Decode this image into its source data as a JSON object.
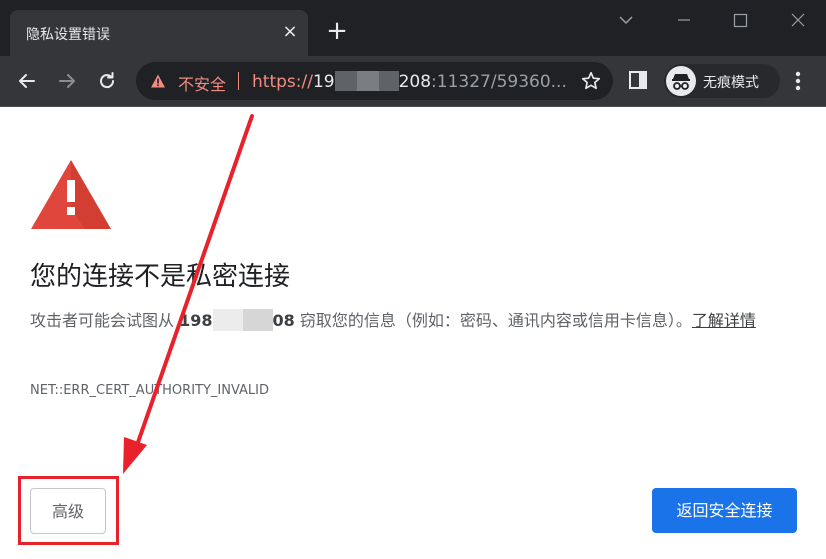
{
  "tab": {
    "title": "隐私设置错误",
    "close": "×"
  },
  "new_tab": "+",
  "toolbar": {
    "security_label": "不安全",
    "url": {
      "scheme": "https://",
      "host_start": "19",
      "host_end": "208",
      "path": ":11327/59360..."
    },
    "incognito_label": "无痕模式"
  },
  "content": {
    "heading": "您的连接不是私密连接",
    "desc_part1": "攻击者可能会试图从 ",
    "desc_host_start": "198",
    "desc_host_end": "08",
    "desc_part2": " 窃取您的信息（例如：密码、通讯内容或信用卡信息）。",
    "learn_more": "了解详情",
    "error_code": "NET::ERR_CERT_AUTHORITY_INVALID",
    "advanced_button": "高级",
    "back_button": "返回安全连接"
  },
  "colors": {
    "chrome_dark": "#202124",
    "toolbar": "#35363a",
    "insecure_red": "#f28b82",
    "error_red": "#e0463b",
    "primary_blue": "#1a73e8",
    "annotation_red": "#e8212b"
  }
}
